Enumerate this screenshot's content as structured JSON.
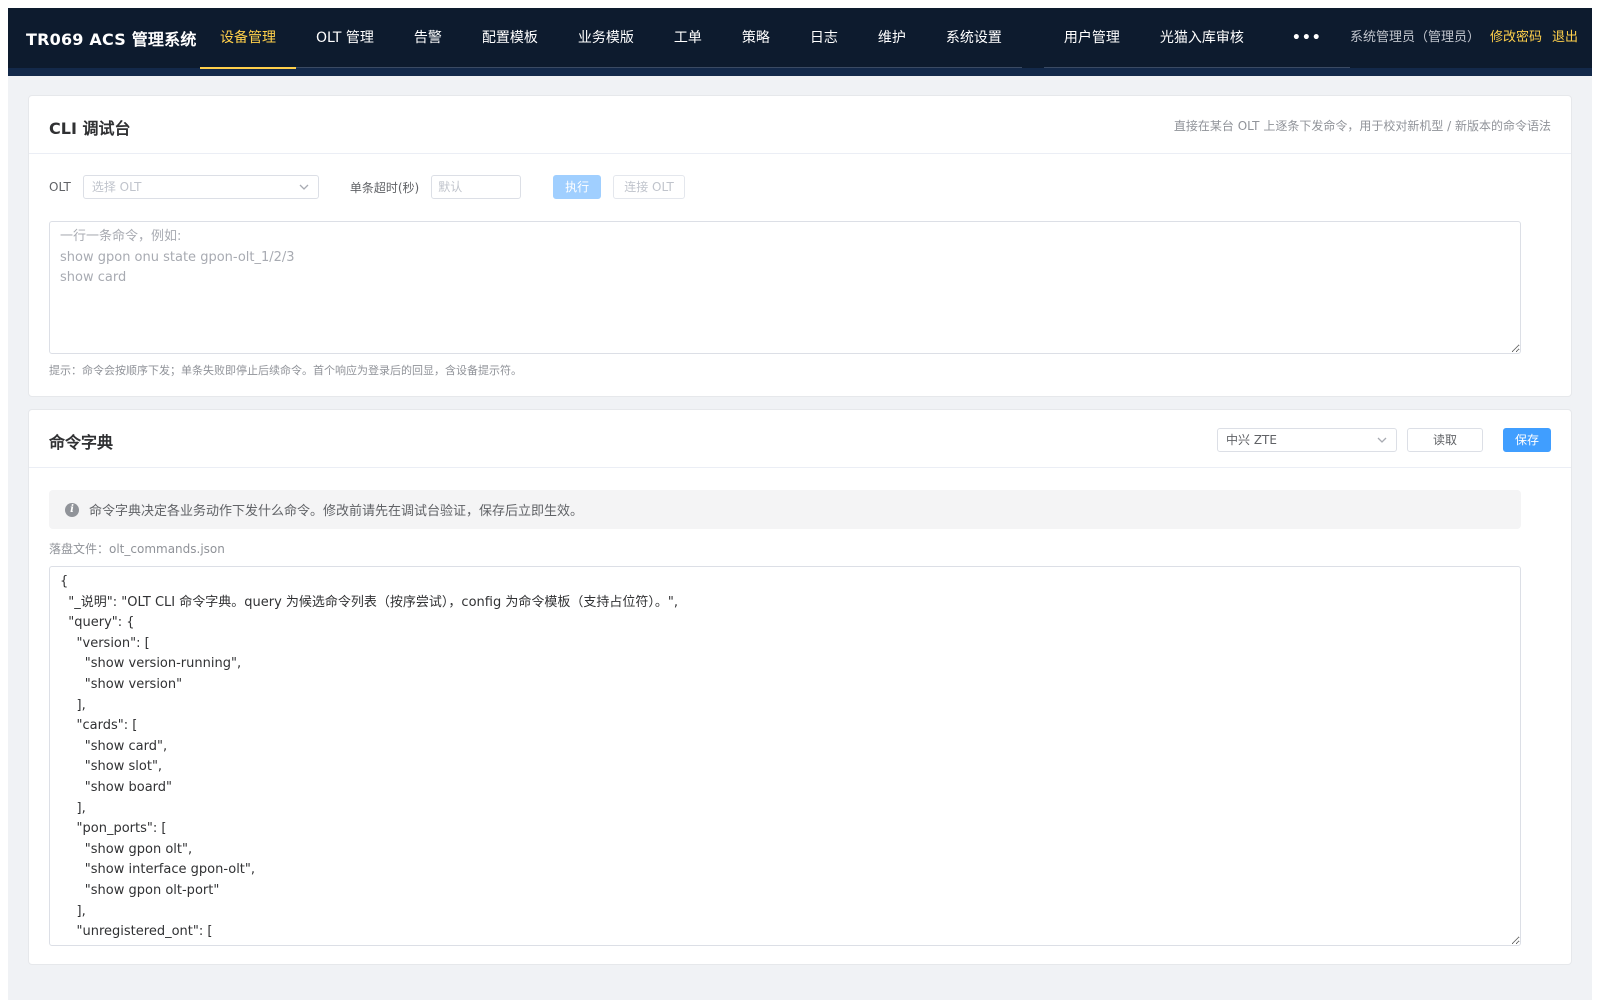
{
  "nav": {
    "brand": "TR069 ACS 管理系统",
    "items": [
      {
        "label": "设备管理",
        "active": true
      },
      {
        "label": "OLT 管理"
      },
      {
        "label": "告警"
      },
      {
        "label": "配置模板"
      },
      {
        "label": "业务模版"
      },
      {
        "label": "工单"
      },
      {
        "label": "策略"
      },
      {
        "label": "日志"
      },
      {
        "label": "维护"
      },
      {
        "label": "系统设置"
      }
    ],
    "items2": [
      {
        "label": "用户管理"
      },
      {
        "label": "光猫入库审核"
      }
    ],
    "more": "•••",
    "user": "系统管理员（管理员）",
    "change_password": "修改密码",
    "logout": "退出",
    "accent_color": "#ffd04b",
    "bg_color": "#0d1b2e"
  },
  "cli": {
    "title": "CLI 调试台",
    "hint": "直接在某台 OLT 上逐条下发命令，用于校对新机型 / 新版本的命令语法",
    "olt_label": "OLT",
    "olt_placeholder": "选择 OLT",
    "timeout_label": "单条超时(秒)",
    "timeout_placeholder": "默认",
    "execute_btn": "执行",
    "connect_btn": "连接 OLT",
    "commands_placeholder": "一行一条命令，例如:\nshow gpon onu state gpon-olt_1/2/3\nshow card",
    "tip": "提示：命令会按顺序下发；单条失败即停止后续命令。首个响应为登录后的回显，含设备提示符。"
  },
  "dict": {
    "title": "命令字典",
    "vendor": "中兴 ZTE",
    "read_btn": "读取",
    "save_btn": "保存",
    "info": "命令字典决定各业务动作下发什么命令。修改前请先在调试台验证，保存后立即生效。",
    "file_label": "落盘文件：olt_commands.json",
    "content": "{\n  \"_说明\": \"OLT CLI 命令字典。query 为候选命令列表（按序尝试），config 为命令模板（支持占位符）。\",\n  \"query\": {\n    \"version\": [\n      \"show version-running\",\n      \"show version\"\n    ],\n    \"cards\": [\n      \"show card\",\n      \"show slot\",\n      \"show board\"\n    ],\n    \"pon_ports\": [\n      \"show gpon olt\",\n      \"show interface gpon-olt\",\n      \"show gpon olt-port\"\n    ],\n    \"unregistered_ont\": ["
  }
}
